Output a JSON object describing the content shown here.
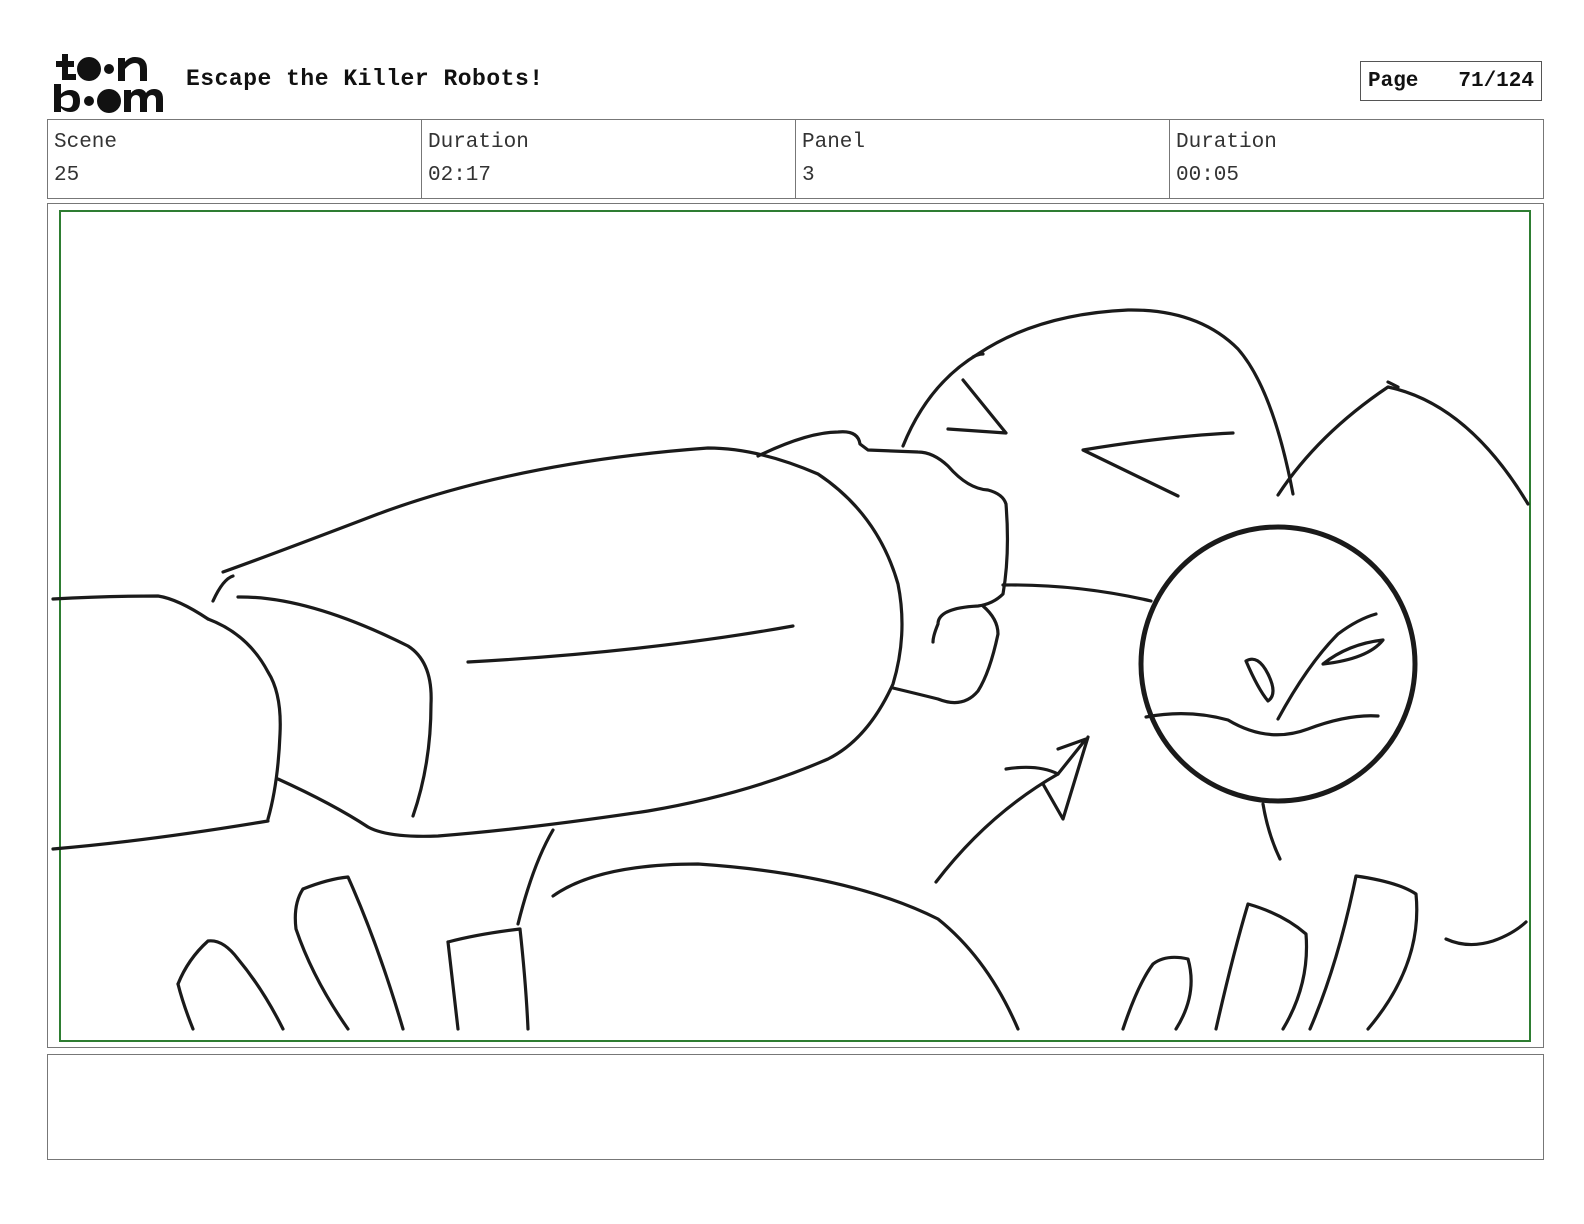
{
  "header": {
    "logo_text": "toon boom",
    "project_title": "Escape the Killer Robots!",
    "page_label": "Page",
    "page_number": "71/124"
  },
  "info": {
    "scene_label": "Scene",
    "scene_value": "25",
    "scene_duration_label": "Duration",
    "scene_duration_value": "02:17",
    "panel_label": "Panel",
    "panel_value": "3",
    "panel_duration_label": "Duration",
    "panel_duration_value": "00:05"
  },
  "notes": {
    "text": ""
  },
  "colors": {
    "safe_frame": "#2e7d32",
    "sketch_stroke": "#1a1a1a",
    "border": "#777777"
  }
}
